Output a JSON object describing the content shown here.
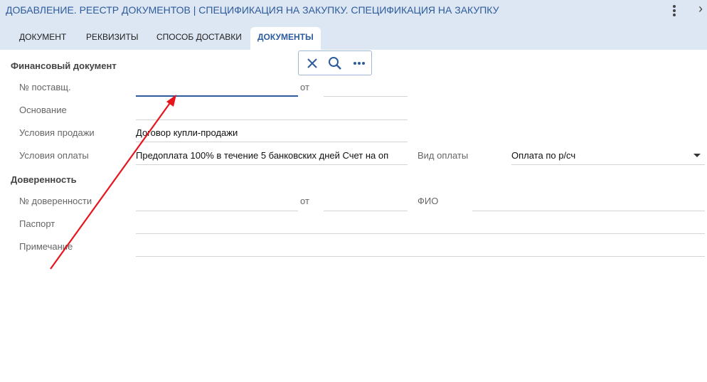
{
  "header": {
    "title": "ДОБАВЛЕНИЕ. РЕЕСТР ДОКУМЕНТОВ | СПЕЦИФИКАЦИЯ НА ЗАКУПКУ. СПЕЦИФИКАЦИЯ НА ЗАКУПКУ"
  },
  "tabs": [
    {
      "label": "ДОКУМЕНТ"
    },
    {
      "label": "РЕКВИЗИТЫ"
    },
    {
      "label": "СПОСОБ ДОСТАВКИ"
    },
    {
      "label": "ДОКУМЕНТЫ",
      "active": true
    }
  ],
  "toolbar": {
    "icons": [
      "close-icon",
      "search-icon",
      "more-horiz-icon"
    ]
  },
  "financial": {
    "section_label": "Финансовый документ",
    "supplier_no_label": "№ поставщ.",
    "supplier_no_value": "",
    "from_label": "от",
    "from_value": "",
    "basis_label": "Основание",
    "basis_value": "",
    "sale_terms_label": "Условия продажи",
    "sale_terms_value": "Договор купли-продажи",
    "payment_terms_label": "Условия оплаты",
    "payment_terms_value": "Предоплата 100% в течение 5 банковских дней Счет на оп",
    "payment_type_label": "Вид оплаты",
    "payment_type_value": "Оплата по р/сч"
  },
  "proxy": {
    "section_label": "Доверенность",
    "proxy_no_label": "№ доверенности",
    "proxy_no_value": "",
    "from_label": "от",
    "from_value": "",
    "fio_label": "ФИО",
    "fio_value": "",
    "passport_label": "Паспорт",
    "passport_value": "",
    "note_label": "Примечание",
    "note_value": ""
  },
  "colors": {
    "header_bg": "#dde6f3",
    "accent": "#2d5c9c",
    "annotation_arrow": "#e8141c"
  }
}
